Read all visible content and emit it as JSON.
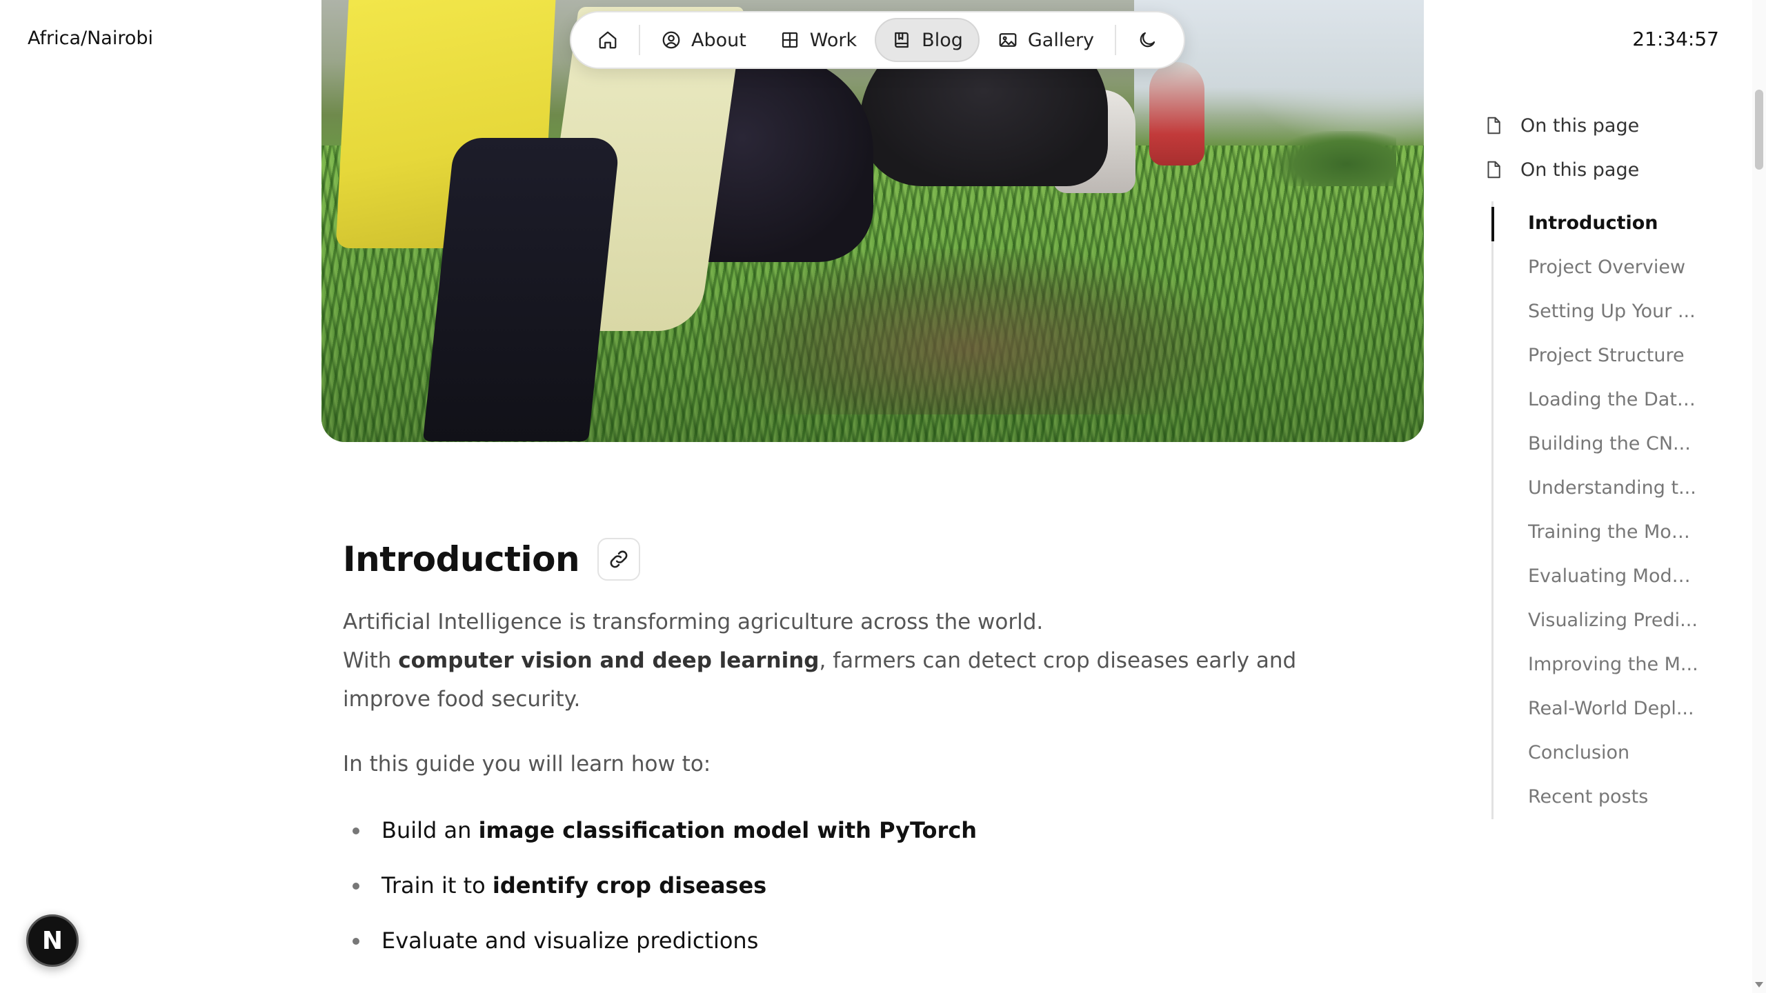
{
  "header": {
    "timezone": "Africa/Nairobi",
    "clock": "21:34:57"
  },
  "nav": {
    "items": [
      {
        "label": "",
        "icon": "home-icon"
      },
      {
        "label": "About",
        "icon": "user-circle-icon"
      },
      {
        "label": "Work",
        "icon": "grid-icon"
      },
      {
        "label": "Blog",
        "icon": "book-icon",
        "active": true
      },
      {
        "label": "Gallery",
        "icon": "image-icon"
      }
    ],
    "theme_icon": "moon-icon"
  },
  "hero": {
    "icon": "photo-farmers-field"
  },
  "article": {
    "heading": "Introduction",
    "para1_line1": "Artificial Intelligence is transforming agriculture across the world.",
    "para1_line2_pre": "With ",
    "para1_line2_bold": "computer vision and deep learning",
    "para1_line2_post": ", farmers can detect crop diseases early and improve food security.",
    "para2": "In this guide you will learn how to:",
    "bullets": [
      {
        "pre": "Build an ",
        "bold": "image classification model with PyTorch"
      },
      {
        "pre": "Train it to ",
        "bold": "identify crop diseases"
      },
      {
        "pre": "Evaluate and visualize predictions",
        "bold": ""
      }
    ]
  },
  "toc": {
    "heads": [
      "On this page",
      "On this page"
    ],
    "items": [
      "Introduction",
      "Project Overview",
      "Setting Up Your ...",
      "Project Structure",
      "Loading the Data...",
      "Building the CN...",
      "Understanding t...",
      "Training the Mod...",
      "Evaluating Mode...",
      "Visualizing Predi...",
      "Improving the M...",
      "Real-World Depl...",
      "Conclusion",
      "Recent posts"
    ],
    "active_index": 0
  },
  "badge": {
    "letter": "N"
  },
  "colors": {
    "text": "#111111",
    "muted": "#555555",
    "toc_muted": "#777777",
    "nav_active_bg": "#e6e6e6"
  }
}
